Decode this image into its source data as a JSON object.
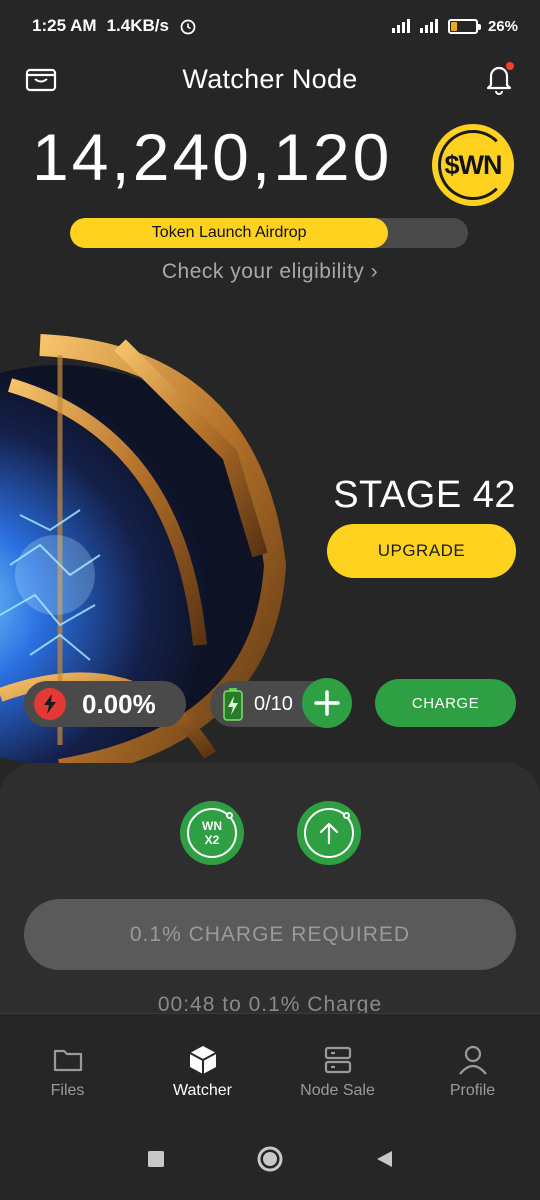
{
  "status_bar": {
    "time": "1:25 AM",
    "net_speed": "1.4KB/s",
    "battery_percent": "26%",
    "icons": [
      "alarm-icon",
      "signal-4g-icon",
      "signal-icon",
      "battery-icon"
    ]
  },
  "header": {
    "title": "Watcher Node",
    "left_icon": "wallet-icon",
    "right_icon": "bell-icon"
  },
  "balance": {
    "amount": "14,240,120",
    "token_symbol": "$WN"
  },
  "airdrop": {
    "label": "Token Launch Airdrop",
    "progress": 0.8,
    "eligibility_link": "Check your eligibility ›"
  },
  "stage": {
    "label": "STAGE 42",
    "upgrade_label": "UPGRADE"
  },
  "charge_row": {
    "percent": "0.00%",
    "battery_count": "0/10",
    "charge_label": "CHARGE"
  },
  "boosts": {
    "multiplier_line1": "WN",
    "multiplier_line2": "X2"
  },
  "charge_required": {
    "label": "0.1% CHARGE REQUIRED",
    "countdown": "00:48 to 0.1% Charge"
  },
  "bottom_nav": {
    "items": [
      {
        "label": "Files",
        "icon": "folder-icon"
      },
      {
        "label": "Watcher",
        "icon": "cube-icon"
      },
      {
        "label": "Node Sale",
        "icon": "server-icon"
      },
      {
        "label": "Profile",
        "icon": "person-icon"
      }
    ],
    "active_index": 1
  },
  "colors": {
    "background": "#262626",
    "accent_yellow": "#ffd21f",
    "accent_green": "#2ea043",
    "danger_red": "#e53935"
  }
}
